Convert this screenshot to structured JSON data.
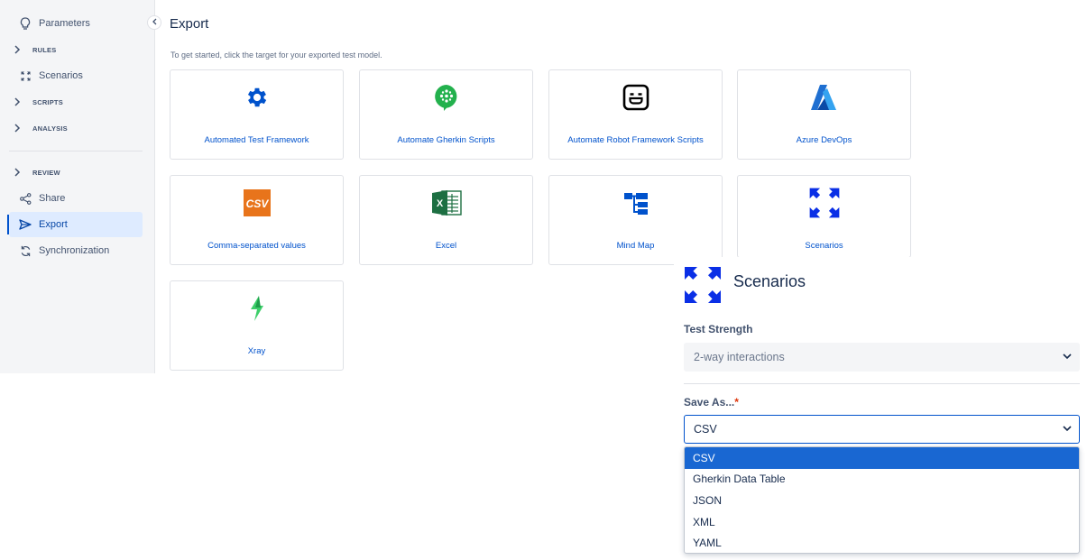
{
  "sidebar": {
    "items": [
      {
        "label": "Parameters",
        "icon": "lightbulb-icon"
      },
      {
        "label": "RULES",
        "icon": "chevron-right-icon"
      },
      {
        "label": "Scenarios",
        "icon": "scenarios-icon"
      },
      {
        "label": "SCRIPTS",
        "icon": "chevron-right-icon"
      },
      {
        "label": "ANALYSIS",
        "icon": "chevron-right-icon"
      },
      {
        "label": "REVIEW",
        "icon": "chevron-right-icon"
      },
      {
        "label": "Share",
        "icon": "share-icon"
      },
      {
        "label": "Export",
        "icon": "send-icon"
      },
      {
        "label": "Synchronization",
        "icon": "sync-icon"
      }
    ],
    "active": "Export",
    "collapse_icon": "chevron-left-icon"
  },
  "main": {
    "title": "Export",
    "intro": "To get started, click the target for your exported test model.",
    "cards": [
      {
        "label": "Automated Test Framework",
        "icon": "gear-icon"
      },
      {
        "label": "Automate Gherkin Scripts",
        "icon": "cucumber-icon"
      },
      {
        "label": "Automate Robot Framework Scripts",
        "icon": "robot-icon"
      },
      {
        "label": "Azure DevOps",
        "icon": "azure-icon"
      },
      {
        "label": "Comma-separated values",
        "icon": "csv-icon",
        "icon_text": "CSV"
      },
      {
        "label": "Excel",
        "icon": "excel-icon",
        "icon_text": "X"
      },
      {
        "label": "Mind Map",
        "icon": "mind-map-icon"
      },
      {
        "label": "Scenarios",
        "icon": "scenarios-icon"
      },
      {
        "label": "Xray",
        "icon": "xray-icon"
      }
    ]
  },
  "popover": {
    "title": "Scenarios",
    "title_icon": "scenarios-icon",
    "strength_label": "Test Strength",
    "strength_value": "2-way interactions",
    "save_label": "Save As...",
    "save_required": "*",
    "save_value": "CSV",
    "options": [
      "CSV",
      "Gherkin Data Table",
      "JSON",
      "XML",
      "YAML"
    ],
    "selected_option": "CSV"
  },
  "colors": {
    "accent": "#0052cc",
    "active_bg": "#deebff",
    "selected_option_bg": "#1967d2",
    "cucumber": "#23b14d",
    "csv": "#e8741b",
    "excel": "#1d6f42",
    "xray": "#3ecf6b"
  }
}
